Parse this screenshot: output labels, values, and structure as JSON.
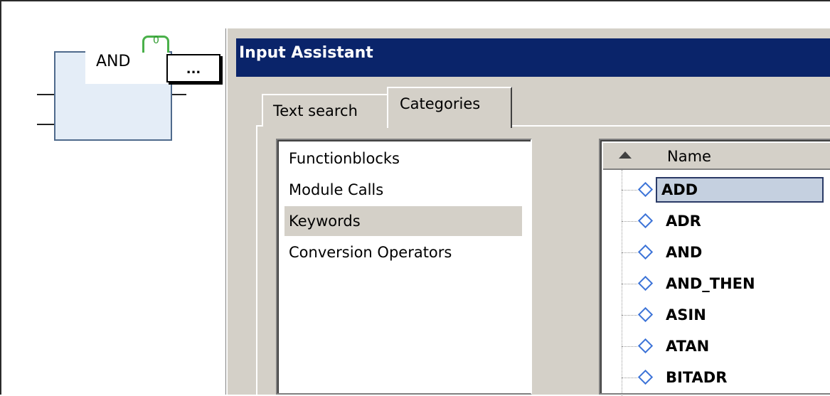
{
  "fbd_block": {
    "label": "AND",
    "badge": "0",
    "ellipsis_label": "..."
  },
  "dialog": {
    "title": "Input Assistant",
    "tabs": [
      {
        "label": "Text search",
        "active": false
      },
      {
        "label": "Categories",
        "active": true
      }
    ],
    "categories": [
      {
        "label": "Functionblocks",
        "selected": false
      },
      {
        "label": "Module Calls",
        "selected": false
      },
      {
        "label": "Keywords",
        "selected": true
      },
      {
        "label": "Conversion Operators",
        "selected": false
      }
    ],
    "name_column": {
      "header": "Name",
      "sort_icon": "sort-ascending-icon",
      "items": [
        {
          "label": "ADD",
          "selected": true
        },
        {
          "label": "ADR",
          "selected": false
        },
        {
          "label": "AND",
          "selected": false
        },
        {
          "label": "AND_THEN",
          "selected": false
        },
        {
          "label": "ASIN",
          "selected": false
        },
        {
          "label": "ATAN",
          "selected": false
        },
        {
          "label": "BITADR",
          "selected": false
        }
      ]
    }
  },
  "colors": {
    "titlebar": "#0a246a",
    "dialog_face": "#d4d0c8",
    "block_fill": "#e4edf7",
    "badge_green": "#4ab04a",
    "item_icon_blue": "#3d74d8"
  }
}
